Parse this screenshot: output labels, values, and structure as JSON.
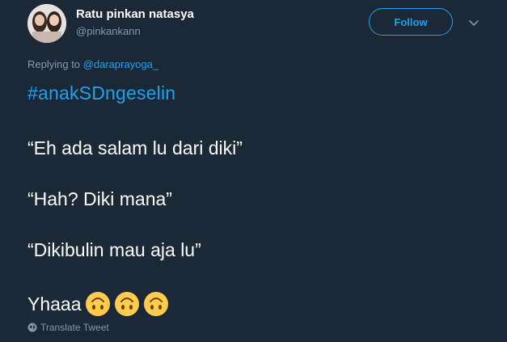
{
  "user": {
    "display_name": "Ratu pinkan natasya",
    "handle": "@pinkankann"
  },
  "follow_button": {
    "label": "Follow"
  },
  "reply": {
    "prefix": "Replying to",
    "mention": "@daraprayoga_"
  },
  "tweet": {
    "hashtag": "#anakSDngeselin",
    "lines": [
      "“Eh ada salam lu dari diki”",
      "“Hah? Diki mana”",
      "“Dikibulin mau aja lu”",
      "Yhaaa"
    ],
    "emoji_count": 3
  },
  "translate": {
    "label": "Translate Tweet"
  },
  "colors": {
    "background": "#1b2836",
    "accent": "#1da1f2",
    "secondary_text": "#8899a6"
  },
  "icons": [
    "avatar-photo",
    "chevron-down-icon",
    "upside-down-face-emoji",
    "globe-icon"
  ]
}
